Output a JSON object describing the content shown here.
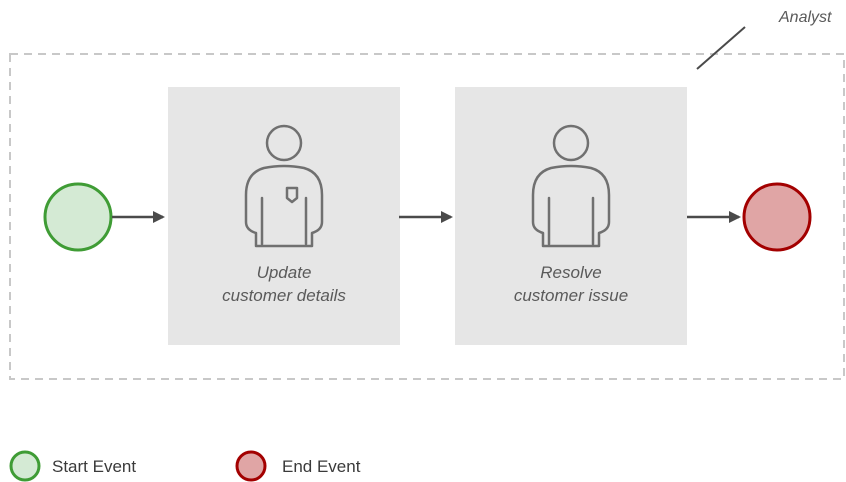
{
  "lane": {
    "label": "Analyst"
  },
  "tasks": [
    {
      "line1": "Update",
      "line2": "customer details"
    },
    {
      "line1": "Resolve",
      "line2": "customer issue"
    }
  ],
  "legend": {
    "start_label": "Start Event",
    "end_label": "End Event"
  },
  "colors": {
    "start_fill": "#d4ead4",
    "start_stroke": "#3f9c35",
    "end_fill": "#e0a5a5",
    "end_stroke": "#a30000",
    "task_fill": "#e6e6e6",
    "arrow": "#4a4a4a",
    "lane_border": "#c8c8c8",
    "icon_stroke": "#707070"
  }
}
